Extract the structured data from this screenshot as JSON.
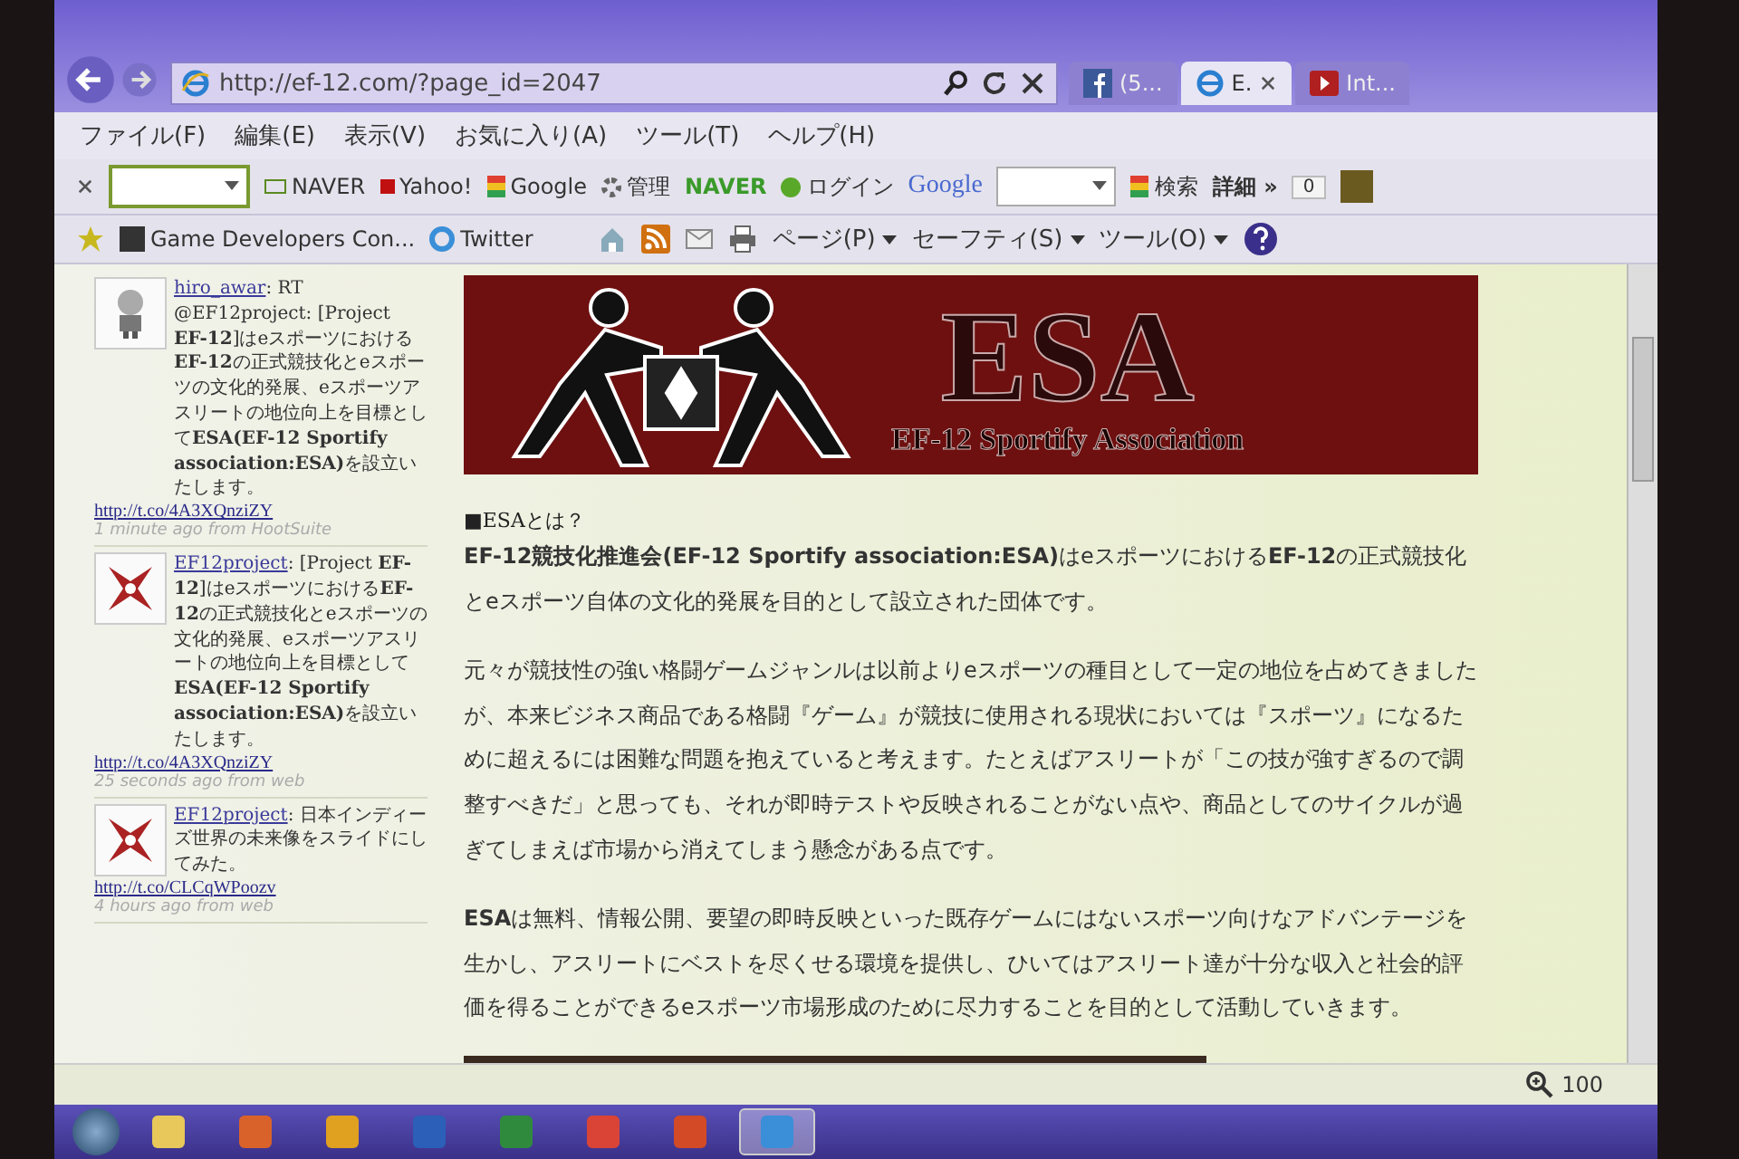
{
  "window": {
    "url": "http://ef-12.com/?page_id=2047",
    "tabs": [
      {
        "label": "(5...",
        "kind": "facebook",
        "selected": false
      },
      {
        "label": "E.",
        "kind": "ie",
        "selected": true
      },
      {
        "label": "Int...",
        "kind": "video",
        "selected": false
      }
    ]
  },
  "menu": [
    "ファイル(F)",
    "編集(E)",
    "表示(V)",
    "お気に入り(A)",
    "ツール(T)",
    "ヘルプ(H)"
  ],
  "links_bar": [
    {
      "label": "NAVER",
      "kind": "box"
    },
    {
      "label": "Yahoo!",
      "kind": "yahoo"
    },
    {
      "label": "Google",
      "kind": "google"
    },
    {
      "label": "管理",
      "kind": "gear"
    },
    {
      "label": "NAVER",
      "kind": "brand"
    },
    {
      "label": "ログイン",
      "kind": "login"
    },
    {
      "label": "Google",
      "kind": "google-search"
    },
    {
      "label": "検索",
      "kind": "google"
    },
    {
      "label": "詳細 »",
      "kind": "plain"
    },
    {
      "label": "0",
      "kind": "counter"
    }
  ],
  "favorites": [
    {
      "label": "Game Developers Con...",
      "kind": "gdc"
    },
    {
      "label": "Twitter",
      "kind": "ie"
    }
  ],
  "command_bar": [
    "ページ(P)",
    "セーフティ(S)",
    "ツール(O)"
  ],
  "tweets": [
    {
      "user": "hiro_awar",
      "kind": "robot",
      "text": ": RT @EF12project: [Project **EF-12**]はeスポーツにおける**EF-12**の正式競技化とeスポーツの文化的発展、eスポーツアスリートの地位向上を目標として**ESA(EF-12 Sportify association:ESA)**を設立いたします。",
      "link": "http://t.co/4A3XQnziZY",
      "time": "1 minute ago from HootSuite"
    },
    {
      "user": "EF12project",
      "kind": "logo",
      "text": ": [Project **EF-12**]はeスポーツにおける**EF-12**の正式競技化とeスポーツの文化的発展、eスポーツアスリートの地位向上を目標として**ESA(EF-12 Sportify association:ESA)**を設立いたします。",
      "link": "http://t.co/4A3XQnziZY",
      "time": "25 seconds ago from web"
    },
    {
      "user": "EF12project",
      "kind": "logo",
      "text": ": 日本インディーズ世界の未来像をスライドにしてみた。",
      "link": "http://t.co/CLCqWPoozv",
      "time": "4 hours ago from web"
    }
  ],
  "banner": {
    "title": "ESA",
    "subtitle": "EF-12 Sportify Association"
  },
  "article": {
    "heading": "■ESAとは？",
    "paragraphs": [
      "**EF-12競技化推進会(EF-12 Sportify association:ESA)**はeスポーツにおける**EF-12**の正式競技化とeスポーツ自体の文化的発展を目的として設立された団体です。",
      "元々が競技性の強い格闘ゲームジャンルは以前よりeスポーツの種目として一定の地位を占めてきましたが、本来ビジネス商品である格闘『ゲーム』が競技に使用される現状においては『スポーツ』になるために超えるには困難な問題を抱えていると考えます。たとえばアスリートが「この技が強すぎるので調整すべきだ」と思っても、それが即時テストや反映されることがない点や、商品としてのサイクルが過ぎてしまえば市場から消えてしまう懸念がある点です。",
      "**ESA**は無料、情報公開、要望の即時反映といった既存ゲームにはないスポーツ向けなアドバンテージを生かし、アスリートにベストを尽くせる環境を提供し、ひいてはアスリート達が十分な収入と社会的評価を得ることができるeスポーツ市場形成のために尽力することを目的として活動していきます。"
    ]
  },
  "status_bar": {
    "zoom": "100"
  },
  "taskbar": [
    {
      "kind": "folder",
      "selected": false
    },
    {
      "kind": "media",
      "selected": false
    },
    {
      "kind": "outlook",
      "selected": false
    },
    {
      "kind": "word",
      "selected": false
    },
    {
      "kind": "excel",
      "selected": false
    },
    {
      "kind": "chrome",
      "selected": false
    },
    {
      "kind": "powerpoint",
      "selected": false
    },
    {
      "kind": "ie",
      "selected": true
    }
  ]
}
